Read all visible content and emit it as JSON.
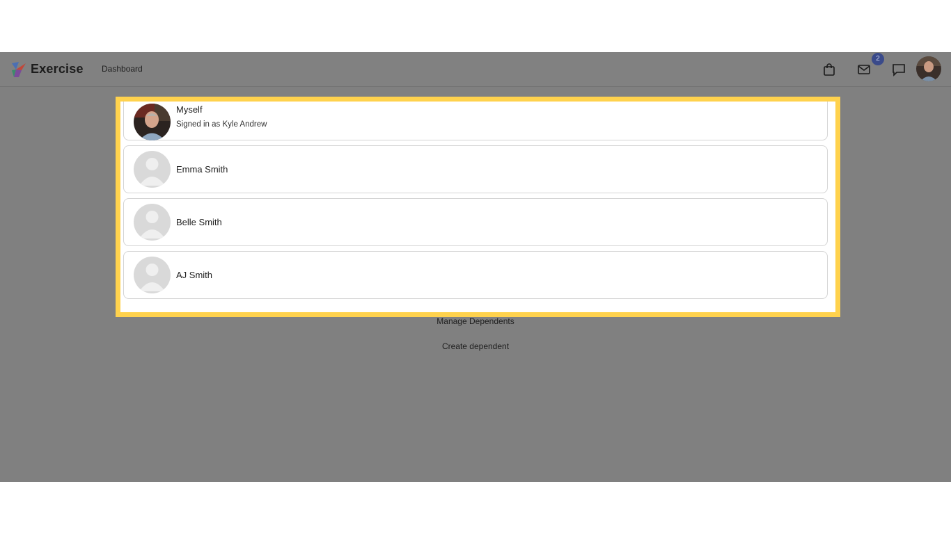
{
  "app": {
    "brand": "Exercise"
  },
  "nav": {
    "dashboard_label": "Dashboard",
    "icons": [
      "shopping-bag-icon",
      "mail-icon",
      "chat-icon"
    ],
    "mail_badge_count": "2"
  },
  "accounts": [
    {
      "name": "Myself",
      "subtitle": "Signed in as Kyle Andrew",
      "avatar": "photo"
    },
    {
      "name": "Emma Smith",
      "avatar": "placeholder"
    },
    {
      "name": "Belle Smith",
      "avatar": "placeholder"
    },
    {
      "name": "AJ Smith",
      "avatar": "placeholder"
    }
  ],
  "links": {
    "manage_dependents": "Manage Dependents",
    "create_dependent": "Create dependent"
  },
  "colors": {
    "highlight": "#ffd24d",
    "overlay": "#808080",
    "badge": "#3a4a8a",
    "placeholder_avatar": "#d9d9d9"
  }
}
